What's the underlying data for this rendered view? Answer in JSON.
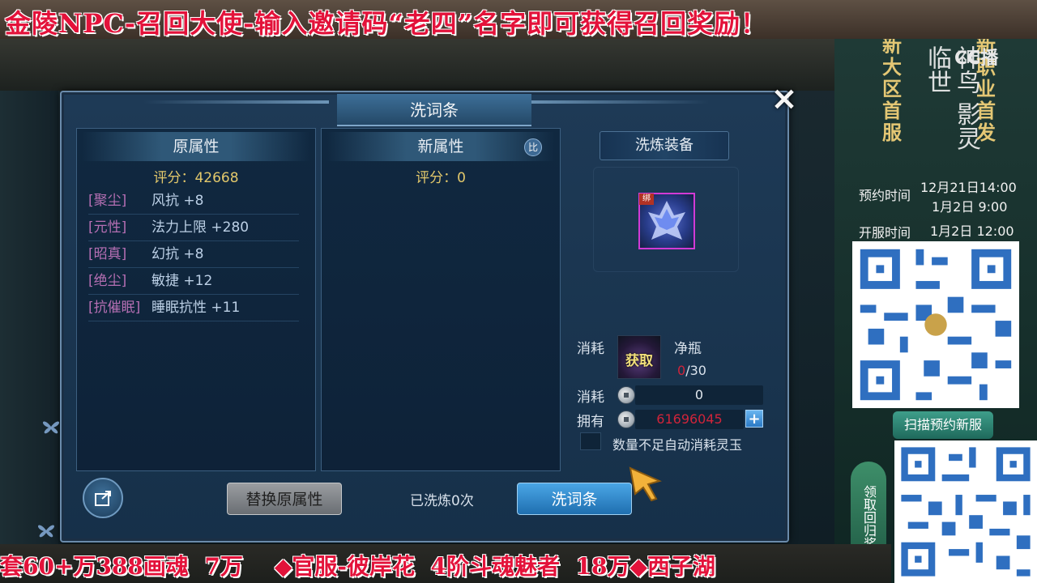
{
  "banner": {
    "top_text": "金陵NPC-召回大使-输入邀请码“老四”名字即可获得召回奖励！",
    "bottom_text": "套60+万388画魂  7万    ◆官服-彼岸花  4阶斗魂魅者  18万◆西子湖"
  },
  "dialog": {
    "title": "洗词条",
    "close_label": "×",
    "original": {
      "header": "原属性",
      "score": "评分：42668",
      "rows": [
        {
          "tag": "[聚尘]",
          "value": "风抗 +8"
        },
        {
          "tag": "[元性]",
          "value": "法力上限 +280"
        },
        {
          "tag": "[昭真]",
          "value": "幻抗 +8"
        },
        {
          "tag": "[绝尘]",
          "value": "敏捷 +12"
        },
        {
          "tag": "[抗催眠]",
          "value": "睡眠抗性 +11"
        }
      ]
    },
    "new": {
      "header": "新属性",
      "score": "评分：0",
      "compare_label": "比"
    },
    "equip": {
      "header": "洗炼装备",
      "bound_label": "绑"
    },
    "consume": {
      "label": "消耗",
      "item_name": "净瓶",
      "obtain_label": "获取",
      "have_count": "0",
      "need_count": "/30"
    },
    "coin_consume": {
      "label": "消耗",
      "value": "0"
    },
    "coin_own": {
      "label": "拥有",
      "value": "61696045",
      "plus": "+"
    },
    "auto_option": "数量不足自动消耗灵玉",
    "replace_button": "替换原属性",
    "wash_count": "已洗炼0次",
    "wash_button": "洗词条"
  },
  "promo": {
    "left_vertical": "新大区首服",
    "right_vertical": "新职业首发",
    "game_title": "神鸟 影灵临世",
    "cc": "CC播",
    "reserve_label": "预约时间",
    "reserve_time_1": "12月21日14:00",
    "reserve_time_2": "1月2日 9:00",
    "open_label": "开服时间",
    "open_time": "1月2日 12:00",
    "scan_button": "扫描预约新服",
    "claim_button": "领取回归奖"
  },
  "colors": {
    "banner_red": "#e3123a",
    "score_gold": "#e3c86b",
    "tag_purple": "#b56fb3",
    "own_red": "#d0243a"
  }
}
